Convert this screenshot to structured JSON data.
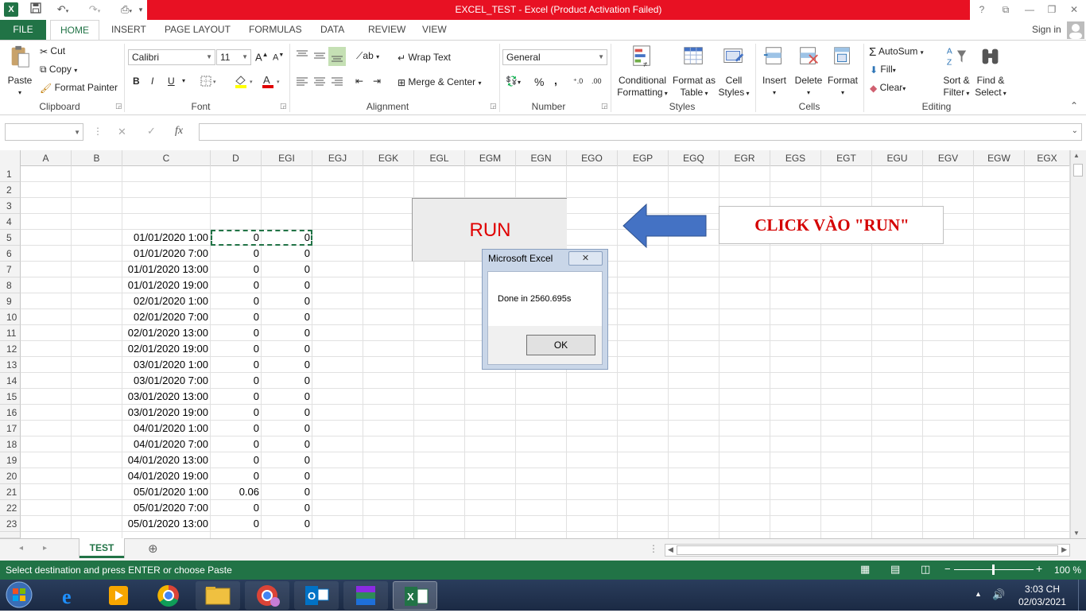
{
  "title_bar": {
    "title": "EXCEL_TEST -  Excel (Product Activation Failed)",
    "help": "?",
    "signin": "Sign in"
  },
  "tabs": [
    "FILE",
    "HOME",
    "INSERT",
    "PAGE LAYOUT",
    "FORMULAS",
    "DATA",
    "REVIEW",
    "VIEW"
  ],
  "ribbon": {
    "clipboard": {
      "paste": "Paste",
      "cut": "Cut",
      "copy": "Copy",
      "format_painter": "Format Painter",
      "label": "Clipboard"
    },
    "font": {
      "name": "Calibri",
      "size": "11",
      "bold": "B",
      "italic": "I",
      "underline": "U",
      "label": "Font"
    },
    "alignment": {
      "wrap": "Wrap Text",
      "merge": "Merge & Center",
      "label": "Alignment"
    },
    "number": {
      "format": "General",
      "percent": "%",
      "comma": ",",
      "label": "Number"
    },
    "styles": {
      "conditional": [
        "Conditional",
        "Formatting"
      ],
      "format_table": [
        "Format as",
        "Table"
      ],
      "cell_styles": [
        "Cell",
        "Styles"
      ],
      "label": "Styles"
    },
    "cells": {
      "insert": "Insert",
      "delete": "Delete",
      "format": "Format",
      "label": "Cells"
    },
    "editing": {
      "autosum": "AutoSum",
      "fill": "Fill",
      "clear": "Clear",
      "sort": [
        "Sort &",
        "Filter"
      ],
      "find": [
        "Find &",
        "Select"
      ],
      "label": "Editing"
    }
  },
  "formula_bar": {
    "name_box": "",
    "fx": "fx",
    "value": ""
  },
  "columns": [
    "A",
    "B",
    "C",
    "D",
    "EGI",
    "EGJ",
    "EGK",
    "EGL",
    "EGM",
    "EGN",
    "EGO",
    "EGP",
    "EGQ",
    "EGR",
    "EGS",
    "EGT",
    "EGU",
    "EGV",
    "EGW",
    "EGX"
  ],
  "rows": [
    {
      "n": "1",
      "c": "",
      "d": "",
      "e": ""
    },
    {
      "n": "2",
      "c": "",
      "d": "",
      "e": ""
    },
    {
      "n": "3",
      "c": "",
      "d": "",
      "e": ""
    },
    {
      "n": "4",
      "c": "",
      "d": "",
      "e": ""
    },
    {
      "n": "5",
      "c": "01/01/2020 1:00",
      "d": "0",
      "e": "0"
    },
    {
      "n": "6",
      "c": "01/01/2020 7:00",
      "d": "0",
      "e": "0"
    },
    {
      "n": "7",
      "c": "01/01/2020 13:00",
      "d": "0",
      "e": "0"
    },
    {
      "n": "8",
      "c": "01/01/2020 19:00",
      "d": "0",
      "e": "0"
    },
    {
      "n": "9",
      "c": "02/01/2020 1:00",
      "d": "0",
      "e": "0"
    },
    {
      "n": "10",
      "c": "02/01/2020 7:00",
      "d": "0",
      "e": "0"
    },
    {
      "n": "11",
      "c": "02/01/2020 13:00",
      "d": "0",
      "e": "0"
    },
    {
      "n": "12",
      "c": "02/01/2020 19:00",
      "d": "0",
      "e": "0"
    },
    {
      "n": "13",
      "c": "03/01/2020 1:00",
      "d": "0",
      "e": "0"
    },
    {
      "n": "14",
      "c": "03/01/2020 7:00",
      "d": "0",
      "e": "0"
    },
    {
      "n": "15",
      "c": "03/01/2020 13:00",
      "d": "0",
      "e": "0"
    },
    {
      "n": "16",
      "c": "03/01/2020 19:00",
      "d": "0",
      "e": "0"
    },
    {
      "n": "17",
      "c": "04/01/2020 1:00",
      "d": "0",
      "e": "0"
    },
    {
      "n": "18",
      "c": "04/01/2020 7:00",
      "d": "0",
      "e": "0"
    },
    {
      "n": "19",
      "c": "04/01/2020 13:00",
      "d": "0",
      "e": "0"
    },
    {
      "n": "20",
      "c": "04/01/2020 19:00",
      "d": "0",
      "e": "0"
    },
    {
      "n": "21",
      "c": "05/01/2020 1:00",
      "d": "0.06",
      "e": "0"
    },
    {
      "n": "22",
      "c": "05/01/2020 7:00",
      "d": "0",
      "e": "0"
    },
    {
      "n": "23",
      "c": "05/01/2020 13:00",
      "d": "0",
      "e": "0"
    }
  ],
  "run_button": {
    "label": "RUN"
  },
  "callout": {
    "text": "CLICK VÀO \"RUN\""
  },
  "dialog": {
    "title": "Microsoft Excel",
    "message": "Done in 2560.695s",
    "ok": "OK",
    "close": "✕"
  },
  "sheet_tab": {
    "name": "TEST",
    "add": "⊕"
  },
  "status": {
    "message": "Select destination and press ENTER or choose Paste",
    "zoom": "100 %"
  },
  "taskbar": {
    "time": "3:03 CH",
    "date": "02/03/2021"
  },
  "colors": {
    "excel_green": "#217346",
    "title_red": "#e81123",
    "run_red": "#e00000",
    "callout_red": "#d40000",
    "arrow_blue": "#4472c4"
  }
}
